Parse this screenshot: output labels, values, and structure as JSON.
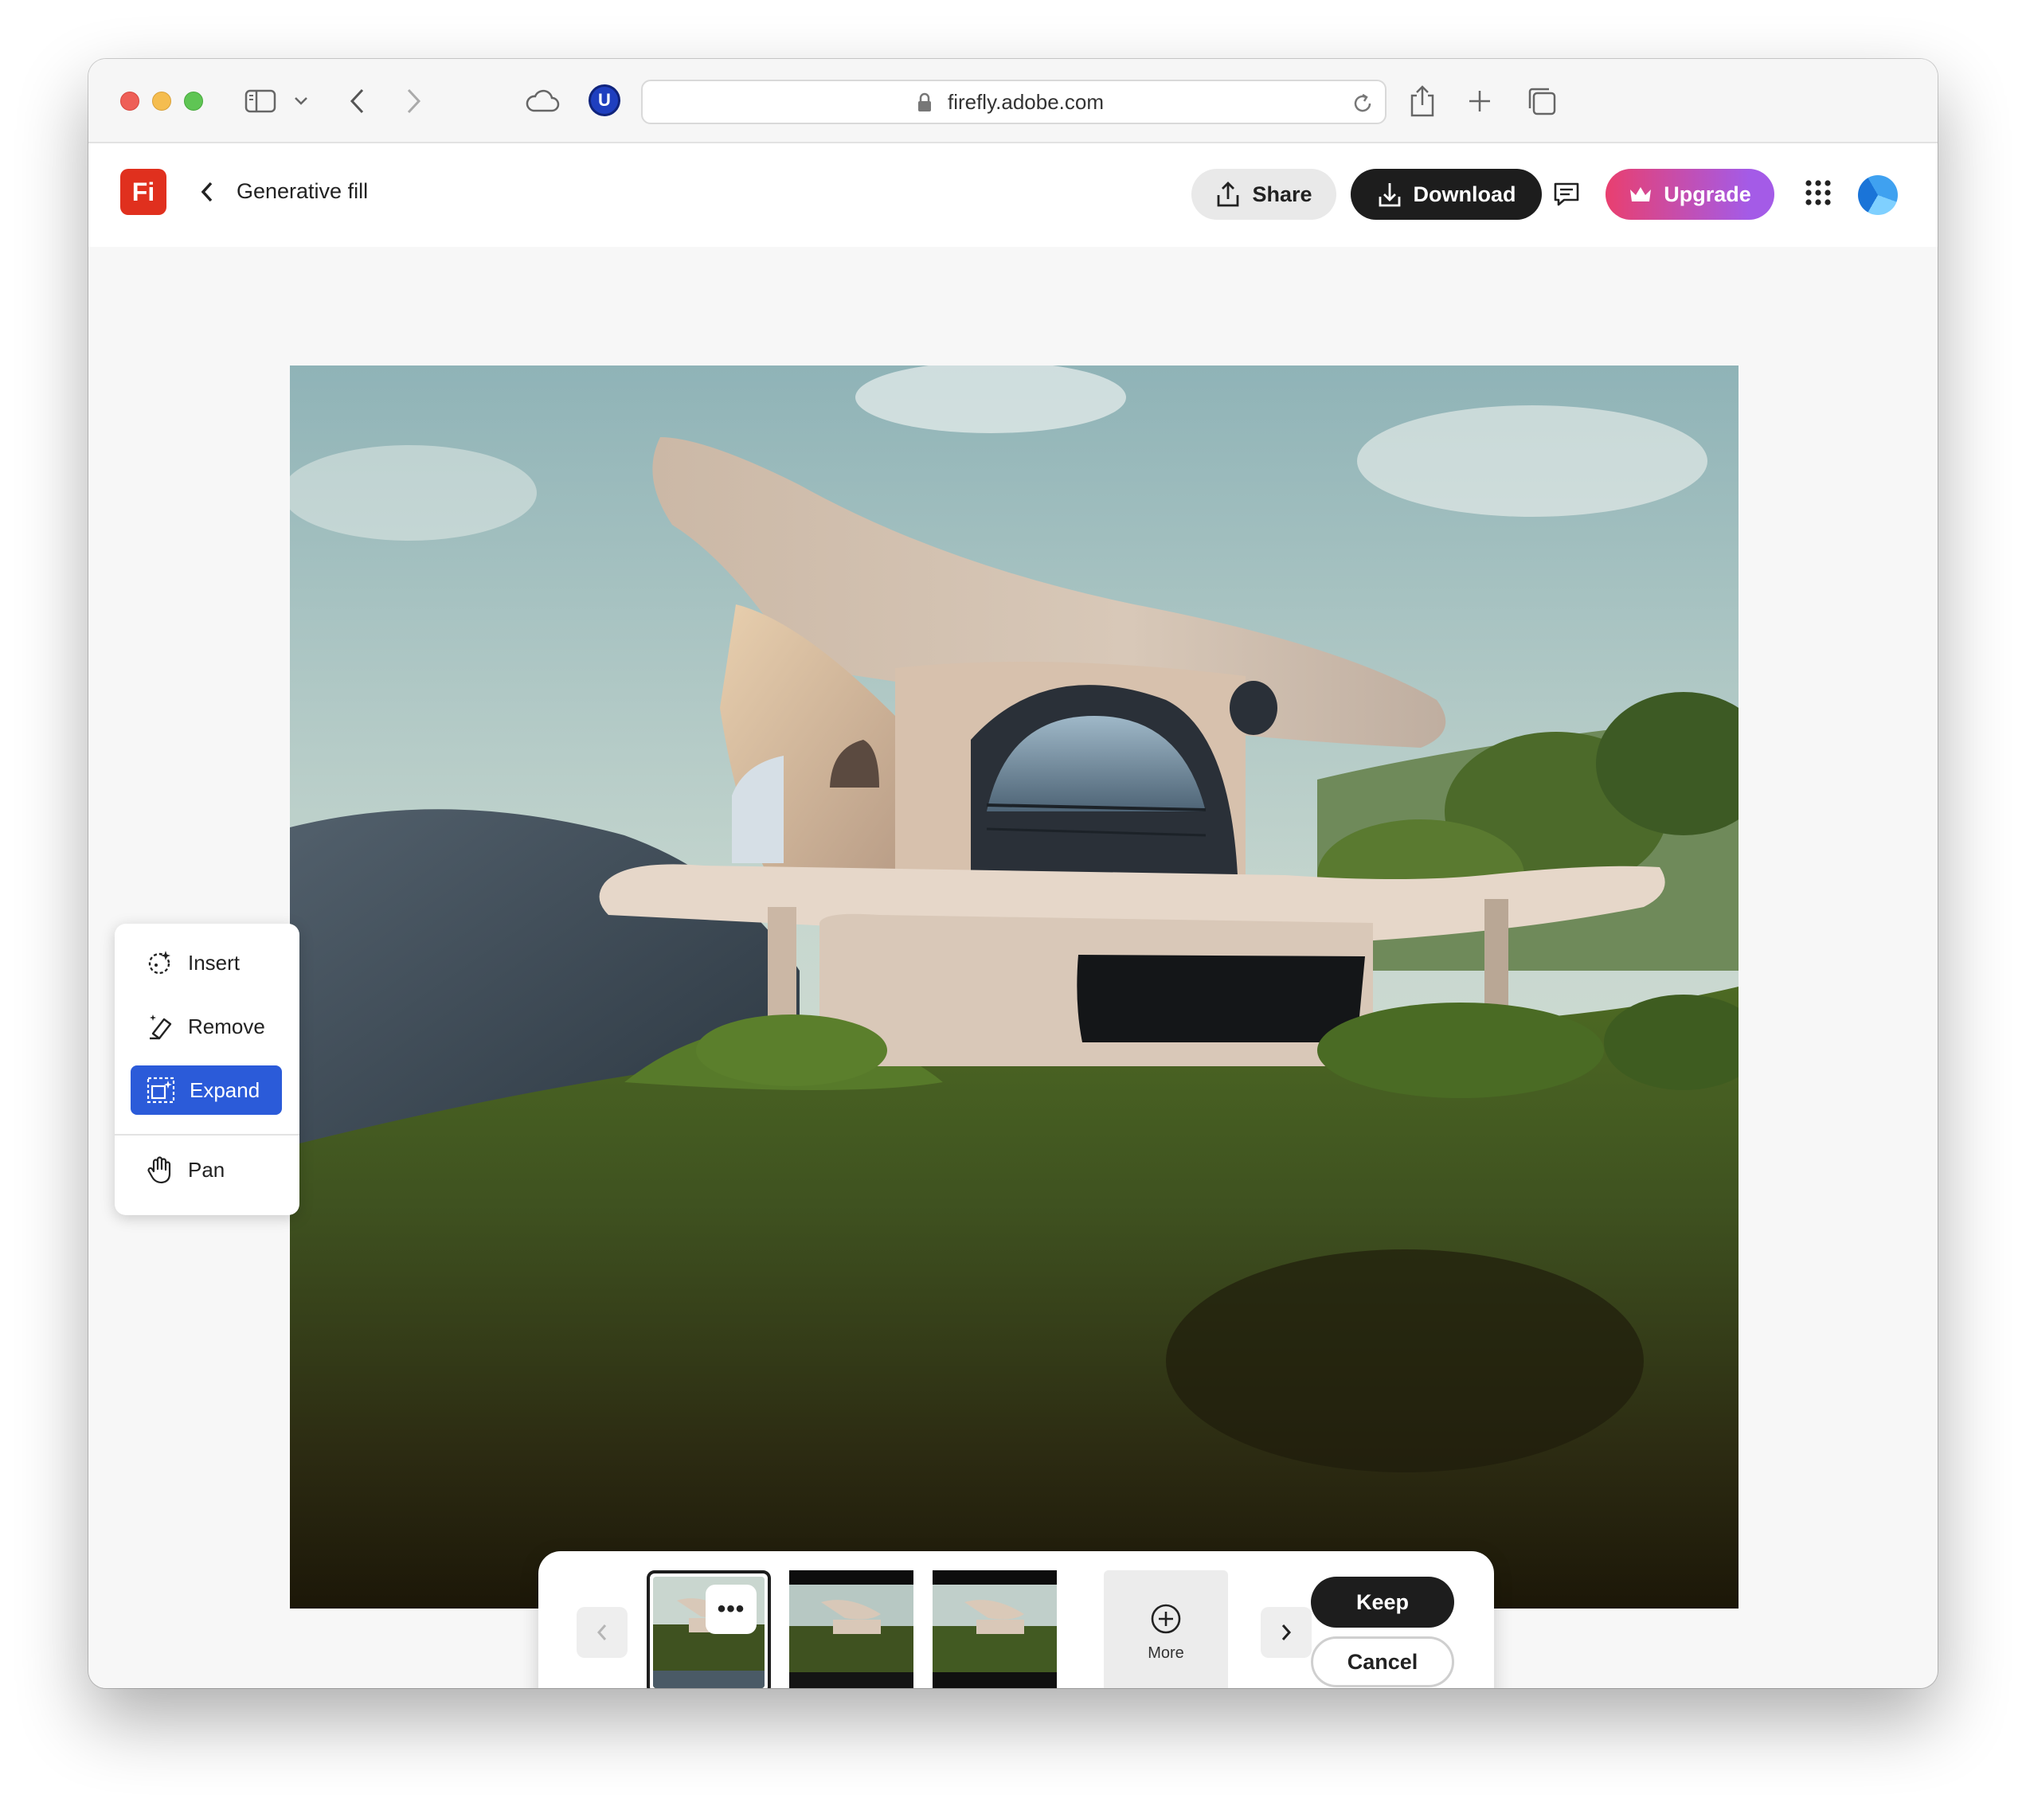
{
  "browser": {
    "url": "firefly.adobe.com",
    "extension_badge": "U"
  },
  "app": {
    "logo_text": "Fi",
    "title": "Generative fill",
    "share_label": "Share",
    "download_label": "Download",
    "upgrade_label": "Upgrade"
  },
  "tools": [
    {
      "label": "Insert",
      "icon": "insert-icon",
      "active": false
    },
    {
      "label": "Remove",
      "icon": "remove-icon",
      "active": false
    },
    {
      "label": "Expand",
      "icon": "expand-icon",
      "active": true
    },
    {
      "label": "Pan",
      "icon": "hand-icon",
      "active": false
    }
  ],
  "variations": {
    "selected_index": 0,
    "more_menu_glyph": "•••",
    "more_label": "More",
    "keep_label": "Keep",
    "cancel_label": "Cancel"
  },
  "colors": {
    "brand_red": "#e0301e",
    "active_tool": "#2b5bd9",
    "dark_button": "#1d1d1d",
    "upgrade_gradient_start": "#e93f6f",
    "upgrade_gradient_end": "#a45be7"
  }
}
